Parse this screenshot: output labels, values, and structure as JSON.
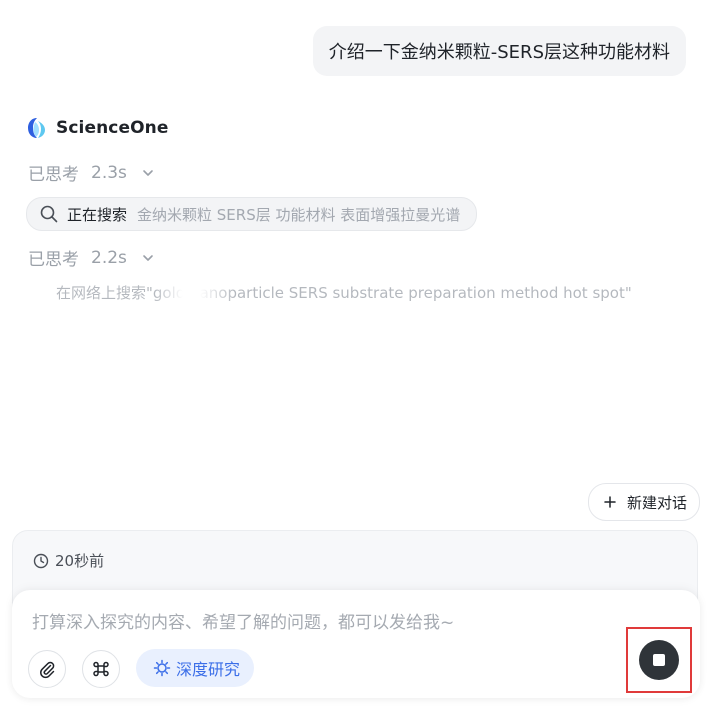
{
  "conversation": {
    "user_message": "介绍一下金纳米颗粒-SERS层这种功能材料",
    "assistant": {
      "brand_name": "ScienceOne",
      "steps": [
        {
          "label": "已思考",
          "duration": "2.3s"
        },
        {
          "label": "已思考",
          "duration": "2.2s"
        }
      ],
      "search": {
        "status": "正在搜索",
        "query": "金纳米颗粒 SERS层 功能材料 表面增强拉曼光谱",
        "icon": "search-icon"
      },
      "web_search": "在网络上搜索\"gold nanoparticle SERS substrate preparation method hot spot\""
    }
  },
  "actions": {
    "new_chat_label": "新建对话"
  },
  "history": {
    "time": "20秒前"
  },
  "composer": {
    "placeholder": "打算深入探究的内容、希望了解的问题，都可以发给我~",
    "value": "",
    "deep_research_label": "深度研究",
    "tools": [
      "paperclip-icon",
      "command-icon",
      "spark-icon",
      "stop-icon"
    ]
  },
  "colors": {
    "accent": "#3b6ee8",
    "accent_bg": "#e9f0fe",
    "stop_button": "#2f3439",
    "highlight_border": "#e03a3a",
    "muted_text": "#9aa0a8"
  }
}
